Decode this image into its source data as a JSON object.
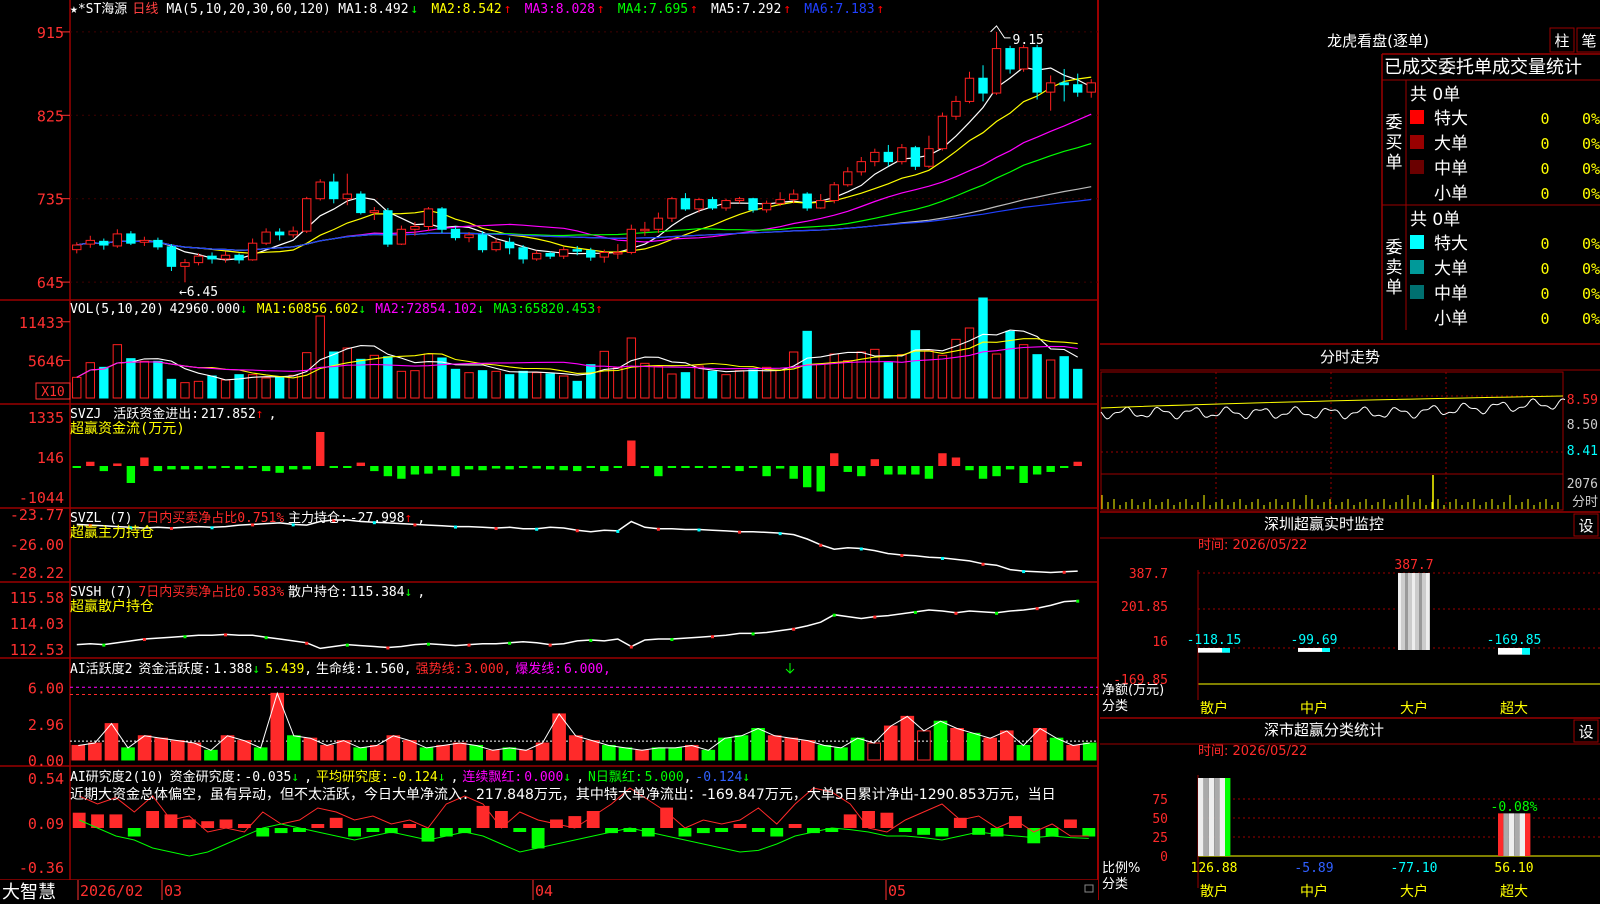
{
  "colors": {
    "up": "#ff2020",
    "down": "#00ffff",
    "ma1": "#ffffff",
    "ma2": "#ffff00",
    "ma3": "#ff00ff",
    "ma4": "#00ff00",
    "ma5": "#bbbbbb",
    "ma6": "#2040ff",
    "grid": "#9b0000",
    "red": "#ff2a2a",
    "green": "#00ff00",
    "yellow": "#ffff00",
    "white": "#ffffff",
    "cyan": "#00ffff",
    "magenta": "#ff00ff",
    "blue": "#3060ff",
    "axis": "#ff3030"
  },
  "main": {
    "title": "★*ST海源",
    "period": "日线",
    "ma_def": "MA(5,10,20,30,60,120)",
    "ma_items": [
      {
        "label": "MA1:",
        "value": "8.492",
        "arrow": "↓"
      },
      {
        "label": "MA2:",
        "value": "8.542",
        "arrow": "↑"
      },
      {
        "label": "MA3:",
        "value": "8.028",
        "arrow": "↑"
      },
      {
        "label": "MA4:",
        "value": "7.695",
        "arrow": "↑"
      },
      {
        "label": "MA5:",
        "value": "7.292",
        "arrow": "↑"
      },
      {
        "label": "MA6:",
        "value": "7.183",
        "arrow": "↑"
      }
    ],
    "yticks": [
      "915",
      "825",
      "735",
      "645"
    ],
    "high_label": "9.15",
    "low_label": "←6.45"
  },
  "vol": {
    "title": "VOL(5,10,20)",
    "value": "42960.000",
    "arrow": "↓",
    "ma_items": [
      {
        "label": "MA1:",
        "value": "60856.602",
        "arrow": "↓"
      },
      {
        "label": "MA2:",
        "value": "72854.102",
        "arrow": "↓"
      },
      {
        "label": "MA3:",
        "value": "65820.453",
        "arrow": "↑"
      }
    ],
    "yticks": [
      "11433",
      "5646"
    ],
    "unit": "X10"
  },
  "svzj": {
    "name": "SVZJ",
    "label1": "活跃资金进出:",
    "value1": "217.852",
    "arrow1": "↑",
    "sep": ",",
    "label2": "超赢资金流(万元)",
    "yticks": [
      "1335",
      "146",
      "-1044"
    ]
  },
  "svzl": {
    "name": "SVZL (7)",
    "ratio": "7日内买卖净占比0.751%",
    "label": "主力持仓:",
    "value": "-27.998",
    "arrow": "↑",
    "sep": ",",
    "label2": "超赢主力持仓",
    "yticks": [
      "-23.77",
      "-26.00",
      "-28.22"
    ]
  },
  "svsh": {
    "name": "SVSH (7)",
    "ratio": "7日内买卖净占比0.583%",
    "label": "散户持仓:",
    "value": "115.384",
    "arrow": "↓",
    "sep": ",",
    "label2": "超赢散户持仓",
    "yticks": [
      "115.58",
      "114.03",
      "112.53"
    ]
  },
  "ai1": {
    "title": "AI活跃度2",
    "l1": "资金活跃度:",
    "v1": "1.388",
    "a1": "↓",
    "v2": "5.439",
    "sep": ",",
    "l3": "生命线:",
    "v3": "1.560",
    "l4": "强势线:",
    "v4": "3.000",
    "l5": "爆发线:",
    "v5": "6.000",
    "yticks": [
      "6.00",
      "2.96",
      "0.00"
    ]
  },
  "ai2": {
    "title": "AI研究度2(10)",
    "l1": "资金研究度:",
    "v1": "-0.035",
    "a1": "↓",
    "sep": ",",
    "l2": "平均研究度:",
    "v2": "-0.124",
    "a2": "↓",
    "l3": "连续飘红:",
    "v3": "0.000",
    "a3": "↓",
    "l4": "N日飘红:",
    "v4": "5.000",
    "v5": "-0.124",
    "a5": "↓",
    "desc": "近期大资金总体偏空，虽有异动，但不太活跃，今日大单净流入：217.848万元，其中特大单净流出：-169.847万元，大单5日累计净出-1290.853万元，当日",
    "yticks": [
      "0.54",
      "0.09",
      "-0.36"
    ]
  },
  "xaxis": {
    "labels": [
      "2026/02",
      "03",
      "04",
      "05"
    ],
    "brand": "大智慧"
  },
  "lhb": {
    "title": "龙虎看盘(逐单)",
    "btn1": "柱",
    "btn2": "笔",
    "subtitle": "已成交委托单成交量统计",
    "buy_side": "委买单",
    "sell_side": "委卖单",
    "buy": {
      "total": "共 0单",
      "rows": [
        {
          "name": "特大",
          "count": "0",
          "pct": "0%",
          "color": "#ff0000"
        },
        {
          "name": "大单",
          "count": "0",
          "pct": "0%",
          "color": "#990000"
        },
        {
          "name": "中单",
          "count": "0",
          "pct": "0%",
          "color": "#6a0000"
        },
        {
          "name": "小单",
          "count": "0",
          "pct": "0%",
          "color": ""
        }
      ]
    },
    "sell": {
      "total": "共 0单",
      "rows": [
        {
          "name": "特大",
          "count": "0",
          "pct": "0%",
          "color": "#00ffff"
        },
        {
          "name": "大单",
          "count": "0",
          "pct": "0%",
          "color": "#009999"
        },
        {
          "name": "中单",
          "count": "0",
          "pct": "0%",
          "color": "#007070"
        },
        {
          "name": "小单",
          "count": "0",
          "pct": "0%",
          "color": ""
        }
      ]
    }
  },
  "intraday": {
    "title": "分时走势",
    "prices": [
      "8.59",
      "8.50",
      "8.41"
    ],
    "volume": "2076",
    "unit": "分时"
  },
  "sz_monitor": {
    "title": "深圳超赢实时监控",
    "btn": "设",
    "time": "时间: 2026/05/22",
    "yticks": [
      "387.7",
      "201.85",
      "16",
      "-169.85"
    ],
    "ylabel1": "净额(万元)",
    "ylabel2": "分类",
    "chart_data": {
      "type": "bar",
      "categories": [
        "散户",
        "中户",
        "大户",
        "超大"
      ],
      "values": [
        -118.15,
        -99.69,
        387.7,
        -169.85
      ],
      "labels": [
        "-118.15",
        "-99.69",
        "387.7",
        "-169.85"
      ]
    }
  },
  "sz_class": {
    "title": "深市超赢分类统计",
    "btn": "设",
    "time": "时间: 2026/05/22",
    "yticks": [
      "75",
      "50",
      "25",
      "0"
    ],
    "ylabel1": "比例%",
    "ylabel2": "分类",
    "chart_data": {
      "type": "bar",
      "categories": [
        "散户",
        "中户",
        "大户",
        "超大"
      ],
      "values": [
        126.88,
        -5.89,
        -77.1,
        56.1
      ],
      "labels": [
        "126.88",
        "-5.89",
        "-77.10",
        "56.10"
      ],
      "top_label": "-0.08%"
    }
  },
  "chart_data": {
    "type": "candlestick",
    "symbol": "★*ST海源",
    "period": "日线",
    "x_labels": [
      "2026/02",
      "03",
      "04",
      "05"
    ],
    "ohlc": [
      [
        6.8,
        6.85,
        6.76,
        6.88
      ],
      [
        6.86,
        6.9,
        6.82,
        6.95
      ],
      [
        6.89,
        6.85,
        6.8,
        6.92
      ],
      [
        6.84,
        6.97,
        6.82,
        7.02
      ],
      [
        6.97,
        6.87,
        6.85,
        7.0
      ],
      [
        6.88,
        6.9,
        6.84,
        6.94
      ],
      [
        6.9,
        6.83,
        6.8,
        6.93
      ],
      [
        6.83,
        6.62,
        6.57,
        6.86
      ],
      [
        6.62,
        6.66,
        6.45,
        6.7
      ],
      [
        6.66,
        6.73,
        6.63,
        6.76
      ],
      [
        6.73,
        6.7,
        6.65,
        6.77
      ],
      [
        6.7,
        6.74,
        6.66,
        6.78
      ],
      [
        6.74,
        6.69,
        6.65,
        6.76
      ],
      [
        6.69,
        6.87,
        6.68,
        6.92
      ],
      [
        6.87,
        6.99,
        6.85,
        7.03
      ],
      [
        6.99,
        6.96,
        6.9,
        7.03
      ],
      [
        6.96,
        7.0,
        6.93,
        7.05
      ],
      [
        7.0,
        7.35,
        6.98,
        7.37
      ],
      [
        7.35,
        7.53,
        7.33,
        7.56
      ],
      [
        7.53,
        7.35,
        7.3,
        7.62
      ],
      [
        7.35,
        7.4,
        7.28,
        7.62
      ],
      [
        7.4,
        7.2,
        7.18,
        7.43
      ],
      [
        7.2,
        7.22,
        7.12,
        7.26
      ],
      [
        7.22,
        6.86,
        6.83,
        7.25
      ],
      [
        6.86,
        7.02,
        6.85,
        7.06
      ],
      [
        7.02,
        7.05,
        6.95,
        7.1
      ],
      [
        7.05,
        7.24,
        7.0,
        7.26
      ],
      [
        7.24,
        7.02,
        6.98,
        7.26
      ],
      [
        7.02,
        6.93,
        6.9,
        7.05
      ],
      [
        6.93,
        6.96,
        6.88,
        6.99
      ],
      [
        6.96,
        6.8,
        6.77,
        7.0
      ],
      [
        6.8,
        6.88,
        6.78,
        6.92
      ],
      [
        6.88,
        6.82,
        6.75,
        6.93
      ],
      [
        6.82,
        6.7,
        6.65,
        6.85
      ],
      [
        6.7,
        6.76,
        6.68,
        6.79
      ],
      [
        6.76,
        6.73,
        6.7,
        6.78
      ],
      [
        6.73,
        6.8,
        6.7,
        6.83
      ],
      [
        6.8,
        6.79,
        6.74,
        6.84
      ],
      [
        6.79,
        6.72,
        6.68,
        6.82
      ],
      [
        6.72,
        6.77,
        6.66,
        6.8
      ],
      [
        6.77,
        6.77,
        6.7,
        6.86
      ],
      [
        6.77,
        7.02,
        6.75,
        7.07
      ],
      [
        7.02,
        7.02,
        6.95,
        7.1
      ],
      [
        7.02,
        7.14,
        6.98,
        7.2
      ],
      [
        7.14,
        7.35,
        7.1,
        7.37
      ],
      [
        7.35,
        7.24,
        7.22,
        7.41
      ],
      [
        7.24,
        7.34,
        7.2,
        7.36
      ],
      [
        7.34,
        7.25,
        7.23,
        7.37
      ],
      [
        7.25,
        7.33,
        7.22,
        7.35
      ],
      [
        7.33,
        7.35,
        7.3,
        7.37
      ],
      [
        7.35,
        7.23,
        7.2,
        7.36
      ],
      [
        7.23,
        7.3,
        7.2,
        7.33
      ],
      [
        7.3,
        7.34,
        7.27,
        7.42
      ],
      [
        7.34,
        7.4,
        7.3,
        7.45
      ],
      [
        7.4,
        7.25,
        7.22,
        7.42
      ],
      [
        7.25,
        7.33,
        7.24,
        7.4
      ],
      [
        7.33,
        7.5,
        7.3,
        7.53
      ],
      [
        7.5,
        7.64,
        7.48,
        7.69
      ],
      [
        7.64,
        7.75,
        7.6,
        7.8
      ],
      [
        7.75,
        7.85,
        7.7,
        7.89
      ],
      [
        7.85,
        7.75,
        7.7,
        7.93
      ],
      [
        7.75,
        7.9,
        7.72,
        7.94
      ],
      [
        7.9,
        7.7,
        7.66,
        7.92
      ],
      [
        7.7,
        7.89,
        7.68,
        8.03
      ],
      [
        7.89,
        8.24,
        7.87,
        8.28
      ],
      [
        8.24,
        8.4,
        8.2,
        8.46
      ],
      [
        8.4,
        8.65,
        8.38,
        8.72
      ],
      [
        8.65,
        8.49,
        8.4,
        8.79
      ],
      [
        8.49,
        8.97,
        8.47,
        9.15
      ],
      [
        8.97,
        8.75,
        8.7,
        9.0
      ],
      [
        8.75,
        8.98,
        8.72,
        9.01
      ],
      [
        8.98,
        8.5,
        8.42,
        9.01
      ],
      [
        8.5,
        8.6,
        8.3,
        8.68
      ],
      [
        8.6,
        8.58,
        8.4,
        8.75
      ],
      [
        8.58,
        8.5,
        8.45,
        8.7
      ],
      [
        8.5,
        8.6,
        8.44,
        8.64
      ]
    ],
    "volume": [
      3100,
      5300,
      4600,
      8000,
      5900,
      5500,
      5500,
      2800,
      2300,
      2500,
      3300,
      2700,
      3500,
      3500,
      3000,
      3200,
      3400,
      6800,
      12300,
      6900,
      7500,
      5800,
      6400,
      6200,
      4000,
      4100,
      6600,
      6000,
      4300,
      3800,
      4100,
      4000,
      3500,
      4000,
      3800,
      3600,
      3300,
      2500,
      5000,
      7000,
      4500,
      9000,
      5200,
      4800,
      3600,
      3800,
      4800,
      4000,
      3500,
      4100,
      4200,
      4600,
      4200,
      6900,
      10000,
      5100,
      6600,
      5600,
      6900,
      7300,
      5300,
      6500,
      10100,
      7100,
      6400,
      8800,
      10500,
      15000,
      6600,
      10000,
      8000,
      6500,
      5700,
      6200,
      4300
    ],
    "ylim": [
      6.45,
      9.15
    ]
  }
}
